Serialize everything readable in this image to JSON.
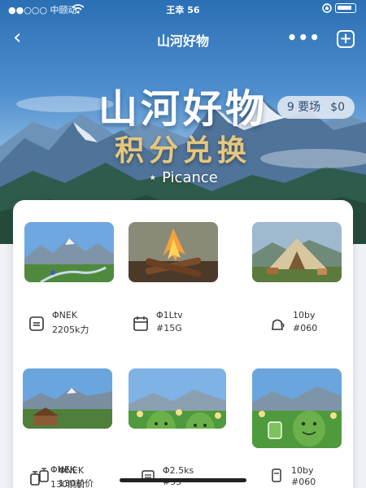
{
  "status_bar": {
    "carrier": "●●○○○ 中颐动",
    "time": "王幸 56"
  },
  "nav": {
    "title": "山河好物"
  },
  "hero": {
    "headline": "山河好物",
    "subline": "积分兑换",
    "brand": "⋆ Picance",
    "badge_left": "9 要场",
    "badge_right": "$0"
  },
  "items": [
    {
      "name": "ΦNEK",
      "points": "2205k力",
      "icon": "backpack-icon",
      "image": "mountain-lake-landscape"
    },
    {
      "name": "Φ1Ltv",
      "points": "#15G",
      "icon": "calendar-icon",
      "image": "campfire"
    },
    {
      "name": "10by",
      "points": "#060",
      "icon": "kettle-icon",
      "image": "glamping-tent"
    },
    {
      "name": "ΦNEK",
      "points": "130前价",
      "icon": "lantern-icon",
      "image": "mountain-cabin"
    },
    {
      "name": "Φ2.5ks",
      "points": "#55",
      "icon": "stove-icon",
      "image": "green-mascots-flowers"
    },
    {
      "name": "10by",
      "points": "#060",
      "icon": "canister-icon",
      "image": "green-mascots-mountains"
    }
  ],
  "colors": {
    "accent_gold": "#e6c77e",
    "sky_blue": "#2b6fb4"
  }
}
